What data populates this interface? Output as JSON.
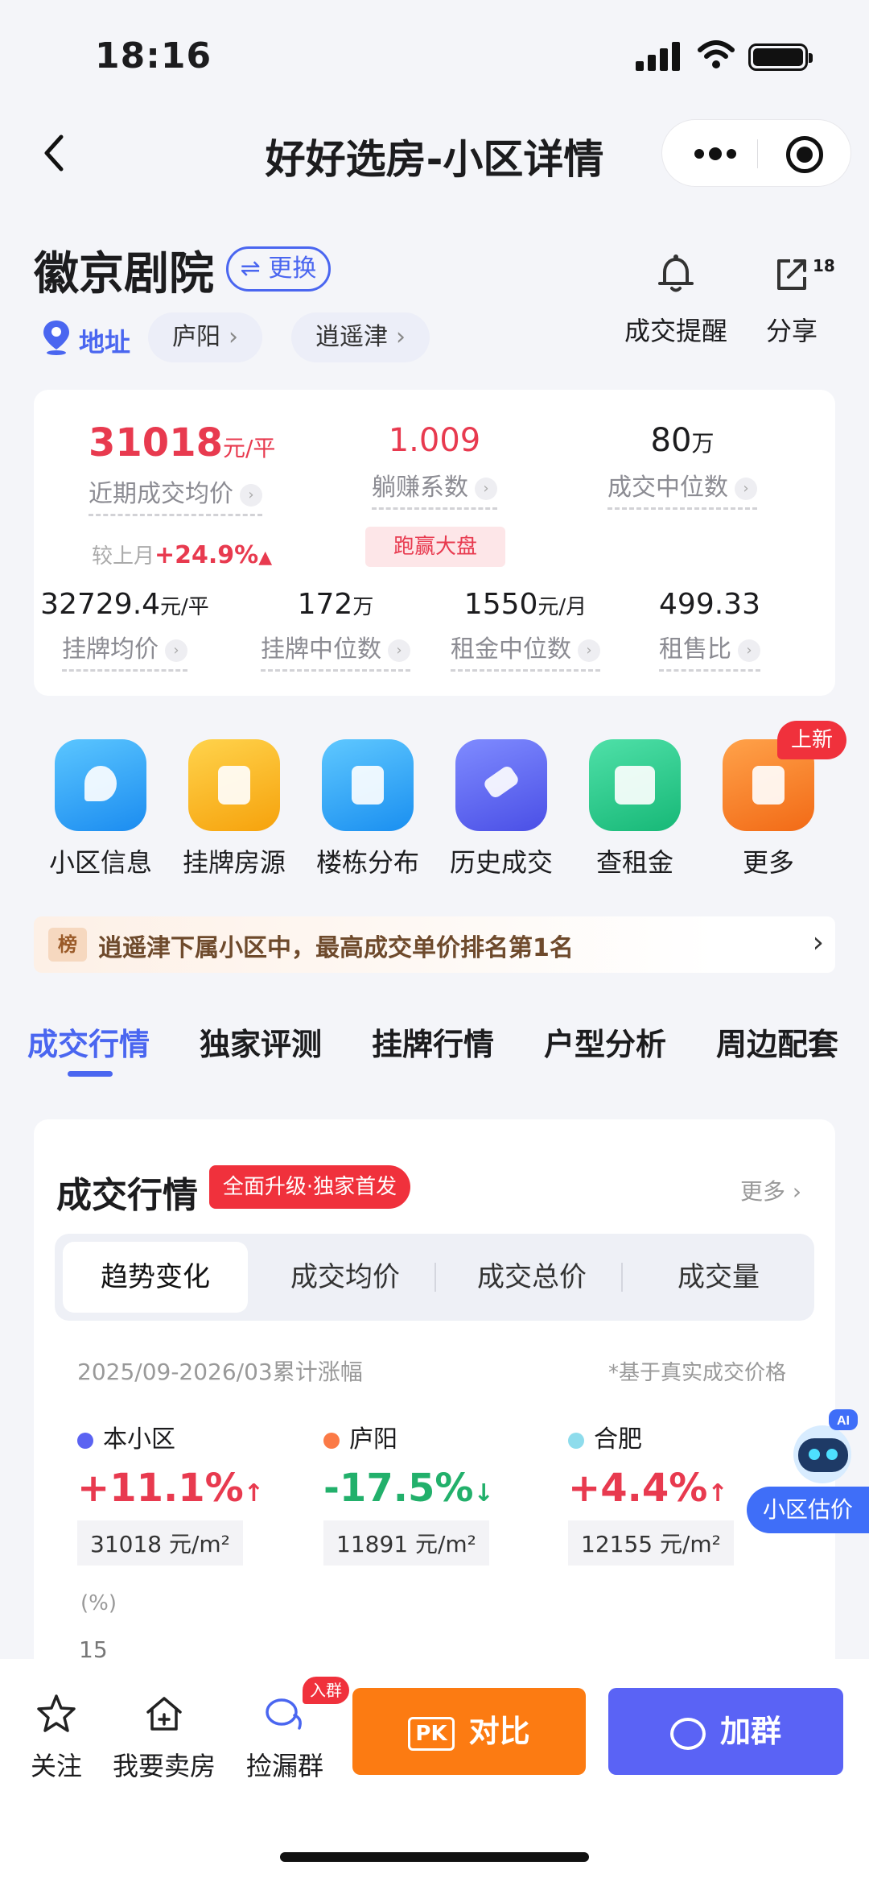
{
  "status": {
    "time": "18:16"
  },
  "nav": {
    "title": "好好选房-小区详情"
  },
  "community": {
    "name": "徽京剧院",
    "switch_label": "⇌ 更换",
    "address_label": "地址",
    "chips": [
      "庐阳",
      "逍遥津"
    ],
    "chip_arrow": "›",
    "alert_label": "成交提醒",
    "share_label": "分享",
    "share_count": "18"
  },
  "stats": {
    "avg_deal_price": "31018",
    "avg_deal_unit": "元/平",
    "avg_deal_label": "近期成交均价",
    "coef": "1.009",
    "coef_label": "躺赚系数",
    "median_deal": "80",
    "median_deal_unit": "万",
    "median_deal_label": "成交中位数",
    "mom_label": "较上月",
    "mom_value": "+24.9%",
    "beat_tag": "跑赢大盘",
    "list_avg": "32729.4",
    "list_avg_unit": "元/平",
    "list_avg_label": "挂牌均价",
    "list_median": "172",
    "list_median_unit": "万",
    "list_median_label": "挂牌中位数",
    "rent_median": "1550",
    "rent_median_unit": "元/月",
    "rent_median_label": "租金中位数",
    "rent_ratio": "499.33",
    "rent_ratio_label": "租售比",
    "help": "›"
  },
  "entries": [
    {
      "label": "小区信息",
      "color": "#2ea6f4"
    },
    {
      "label": "挂牌房源",
      "color": "#fbb21f"
    },
    {
      "label": "楼栋分布",
      "color": "#27a9f5"
    },
    {
      "label": "历史成交",
      "color": "#5b63f2"
    },
    {
      "label": "查租金",
      "color": "#25c98a"
    },
    {
      "label": "更多",
      "color": "#fb7a28"
    }
  ],
  "new_tag": "上新",
  "rank": {
    "tag": "榜",
    "text": "逍遥津下属小区中，最高成交单价排名第1名",
    "arrow": "›"
  },
  "tabs": [
    "成交行情",
    "独家评测",
    "挂牌行情",
    "户型分析",
    "周边配套"
  ],
  "market": {
    "title": "成交行情",
    "upgrade_tag": "全面升级·独家首发",
    "more": "更多 ›",
    "segments": [
      "趋势变化",
      "成交均价",
      "成交总价",
      "成交量"
    ],
    "period": "2025/09-2026/03累计涨幅",
    "note": "*基于真实成交价格",
    "compare": [
      {
        "name": "本小区",
        "dot": "#5b63f2",
        "pct": "+11.1%",
        "arrow": "↑",
        "price": "31018 元/m²"
      },
      {
        "name": "庐阳",
        "dot": "#fb7a46",
        "pct": "-17.5%",
        "arrow": "↓",
        "price": "11891 元/m²"
      },
      {
        "name": "合肥",
        "dot": "#8edcec",
        "pct": "+4.4%",
        "arrow": "↑",
        "price": "12155 元/m²"
      }
    ],
    "y_unit": "(%)",
    "y_first_tick": "15"
  },
  "ai": {
    "badge": "AI",
    "button": "小区估价"
  },
  "bottom": {
    "follow": "关注",
    "sell": "我要卖房",
    "group": "捡漏群",
    "join_tag": "入群",
    "compare": "对比",
    "compare_badge": "PK",
    "add_group": "加群"
  }
}
